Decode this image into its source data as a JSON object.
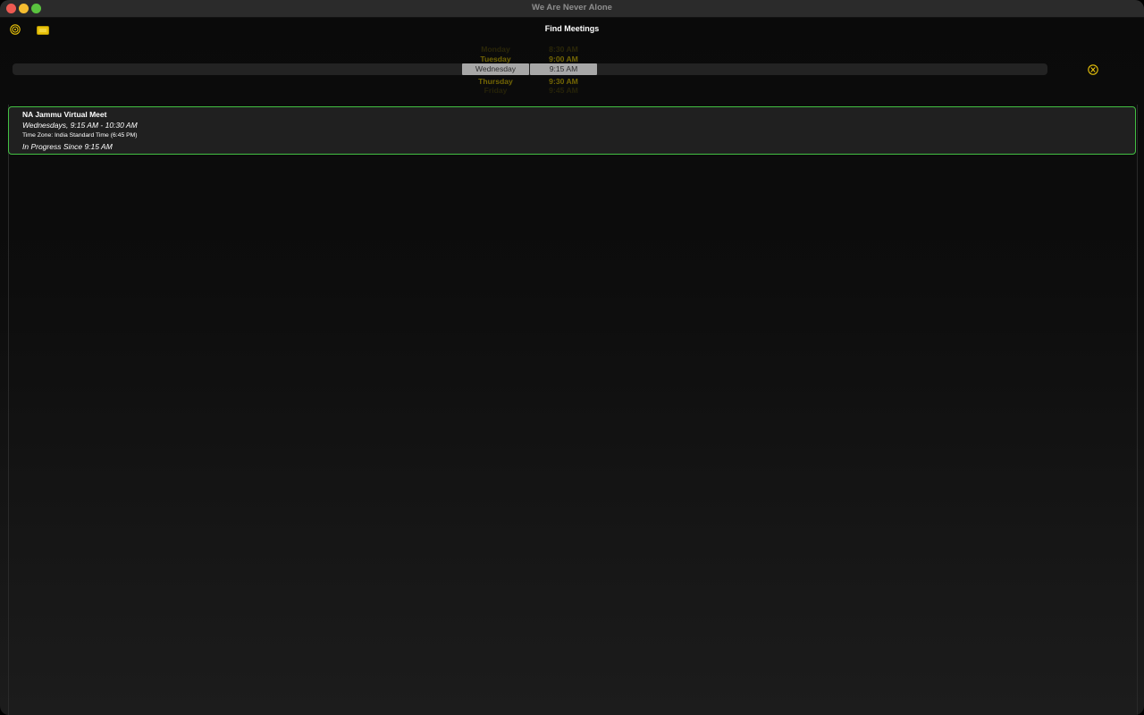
{
  "window": {
    "title": "We Are Never Alone"
  },
  "header": {
    "title": "Find Meetings"
  },
  "icons": {
    "location": "target-icon",
    "display": "monitor-icon",
    "clear": "close-circle-icon",
    "accent": "#e8c20a"
  },
  "picker": {
    "days": [
      "Monday",
      "Tuesday",
      "Wednesday",
      "Thursday",
      "Friday"
    ],
    "selected_day": "Wednesday",
    "times": [
      "8:30 AM",
      "9:00 AM",
      "9:15 AM",
      "9:30 AM",
      "9:45 AM"
    ],
    "selected_time": "9:15 AM"
  },
  "meetings": [
    {
      "name": "NA Jammu Virtual Meet",
      "schedule": "Wednesdays, 9:15 AM - 10:30 AM",
      "timezone": "Time Zone: India Standard Time (6:45 PM)",
      "status": "In Progress Since 9:15 AM",
      "border_color": "#43c043"
    }
  ]
}
